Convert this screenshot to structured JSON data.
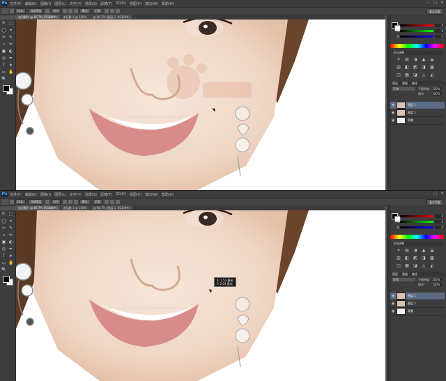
{
  "menus": [
    "文件(F)",
    "编辑(E)",
    "图像(I)",
    "图层(L)",
    "文字(Y)",
    "选择(S)",
    "滤镜(T)",
    "3D(D)",
    "视图(V)",
    "窗口(W)",
    "帮助(H)"
  ],
  "app_logo": "Ps",
  "window_controls": [
    "–",
    "□",
    "✕"
  ],
  "options": {
    "sample_label": "样本:",
    "sample_value": "当前图层",
    "aligned_label": "对齐",
    "mode_label": "模式:",
    "mode_value": "正常"
  },
  "workspace_label": "基本功能",
  "shots": [
    {
      "tabs": [
        "宝贝照片 @ 66.7% (RGB/8#)",
        "未标题-1 @ 100%",
        "@ 66.7% (图层 1, RGB/8#)"
      ],
      "tooltip": null
    },
    {
      "tabs": [
        "宝贝照片 @ 66.7% (RGB/8#)",
        "未标题-1 @ 100%",
        "@ 66.7% (图层 1, RGB/8#)"
      ],
      "tooltip": [
        "X: 1.52 厘米",
        "Y: 2.03 厘米"
      ]
    }
  ],
  "tools": [
    "⇱",
    "⬚",
    "◯",
    "⌖",
    "✂",
    "✎",
    "⌕",
    "✏",
    "▣",
    "◐",
    "◎",
    "✒",
    "T",
    "➤",
    "▭",
    "✋",
    "🔍"
  ],
  "color_panel": {
    "sliders": [
      {
        "label": "R",
        "value": "0",
        "color": "#d04040"
      },
      {
        "label": "G",
        "value": "0",
        "color": "#40b040"
      },
      {
        "label": "B",
        "value": "0",
        "color": "#4070d0"
      }
    ]
  },
  "adjustments": {
    "title": "添加调整",
    "icons": [
      "☀",
      "▤",
      "◑",
      "▲",
      "◒",
      "▥",
      "◧",
      "◩",
      "◨",
      "▩",
      "◫",
      "▦",
      "◪",
      "◬",
      "◭"
    ]
  },
  "layers_panel": {
    "tabs": [
      "图层",
      "通道",
      "路径"
    ],
    "blend_mode": "正常",
    "opacity_label": "不透明度:",
    "opacity_value": "100%",
    "fill_label": "填充:",
    "fill_value": "100%",
    "layers": [
      {
        "name": "图层 1",
        "selected": true,
        "thumb": "photo"
      },
      {
        "name": "图层 1",
        "selected": false,
        "thumb": "photo"
      },
      {
        "name": "背景",
        "selected": false,
        "thumb": "white"
      }
    ]
  }
}
